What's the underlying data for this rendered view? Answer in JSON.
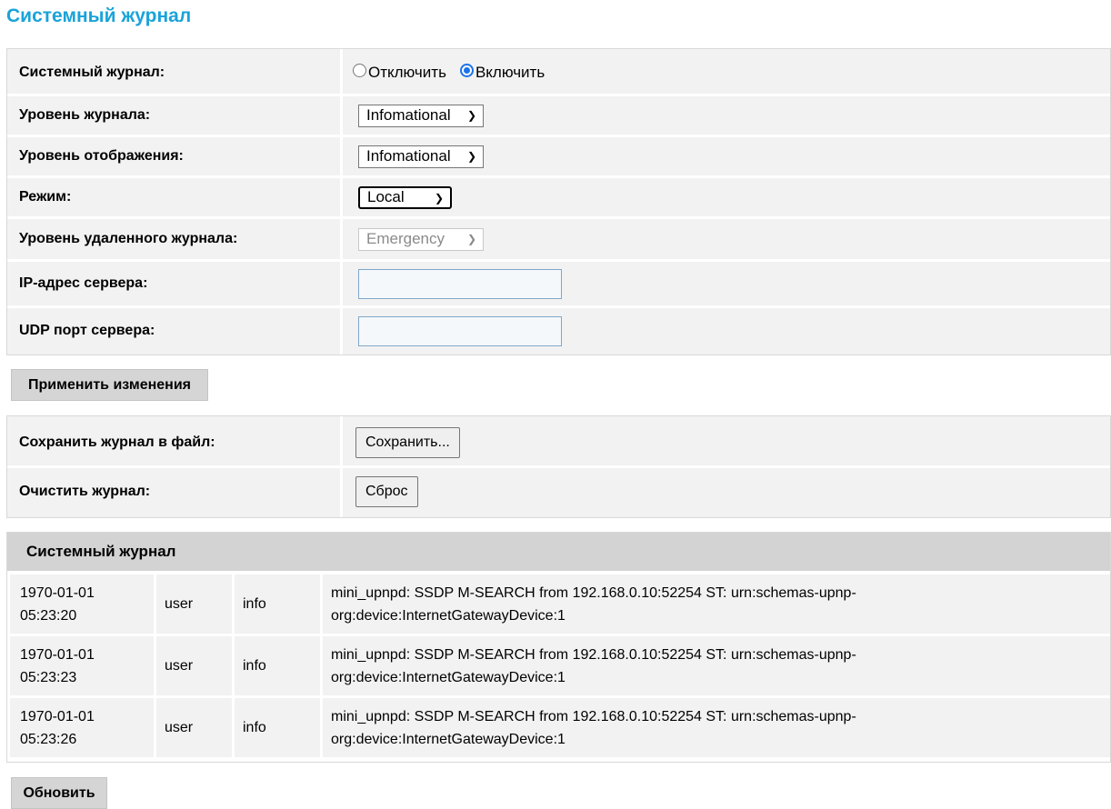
{
  "page": {
    "title": "Системный журнал"
  },
  "settings": {
    "syslog_label": "Системный журнал:",
    "radio_off": "Отключить",
    "radio_on": "Включить",
    "radio_selected": "Включить",
    "log_level_label": "Уровень журнала:",
    "log_level_value": "Infomational",
    "display_level_label": "Уровень отображения:",
    "display_level_value": "Infomational",
    "mode_label": "Режим:",
    "mode_value": "Local",
    "remote_level_label": "Уровень удаленного журнала:",
    "remote_level_value": "Emergency",
    "server_ip_label": "IP-адрес сервера:",
    "server_ip_value": "",
    "udp_port_label": "UDP порт сервера:",
    "udp_port_value": ""
  },
  "apply_button": "Применить изменения",
  "file_actions": {
    "save_label": "Сохранить журнал в файл:",
    "save_button": "Сохранить...",
    "clear_label": "Очистить журнал:",
    "clear_button": "Сброс"
  },
  "log": {
    "header": "Системный журнал",
    "rows": [
      {
        "date": "1970-01-01",
        "time": "05:23:20",
        "facility": "user",
        "level": "info",
        "message": "mini_upnpd: SSDP M-SEARCH from 192.168.0.10:52254 ST: urn:schemas-upnp-org:device:InternetGatewayDevice:1"
      },
      {
        "date": "1970-01-01",
        "time": "05:23:23",
        "facility": "user",
        "level": "info",
        "message": "mini_upnpd: SSDP M-SEARCH from 192.168.0.10:52254 ST: urn:schemas-upnp-org:device:InternetGatewayDevice:1"
      },
      {
        "date": "1970-01-01",
        "time": "05:23:26",
        "facility": "user",
        "level": "info",
        "message": "mini_upnpd: SSDP M-SEARCH from 192.168.0.10:52254 ST: urn:schemas-upnp-org:device:InternetGatewayDevice:1"
      }
    ]
  },
  "refresh_button": "Обновить",
  "colors": {
    "title": "#1aa3d9",
    "radio_accent": "#1a73e8",
    "header_bg": "#d3d3d3"
  }
}
